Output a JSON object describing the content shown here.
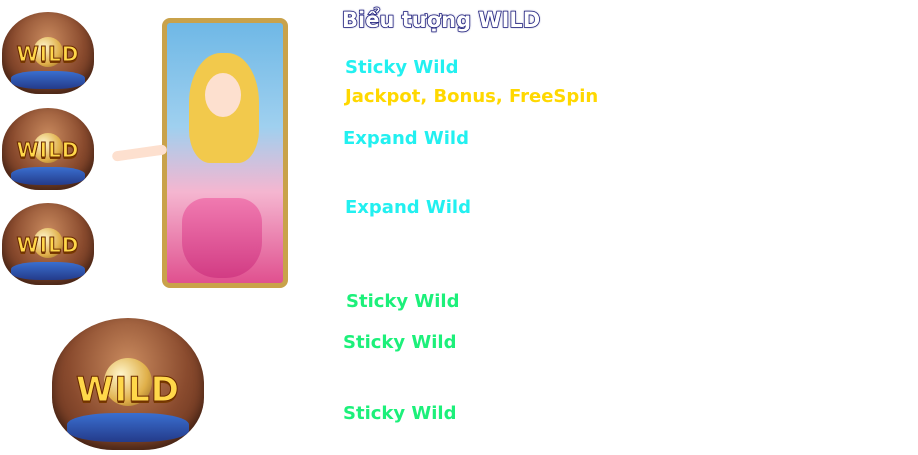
{
  "title": "Biểu tượng WILD",
  "symbols": {
    "wild_label": "WILD"
  },
  "items": [
    {
      "text": "Sticky Wild",
      "color": "#22f0f0"
    },
    {
      "text": "Jackpot, Bonus, FreeSpin",
      "color": "#ffd800"
    },
    {
      "text": "Expand Wild",
      "color": "#22f0f0"
    },
    {
      "text": "Expand Wild",
      "color": "#22f0f0"
    },
    {
      "text": "Sticky Wild",
      "color": "#1cf07a"
    },
    {
      "text": "Sticky Wild",
      "color": "#1cf07a"
    },
    {
      "text": "Sticky Wild",
      "color": "#1cf07a"
    }
  ]
}
